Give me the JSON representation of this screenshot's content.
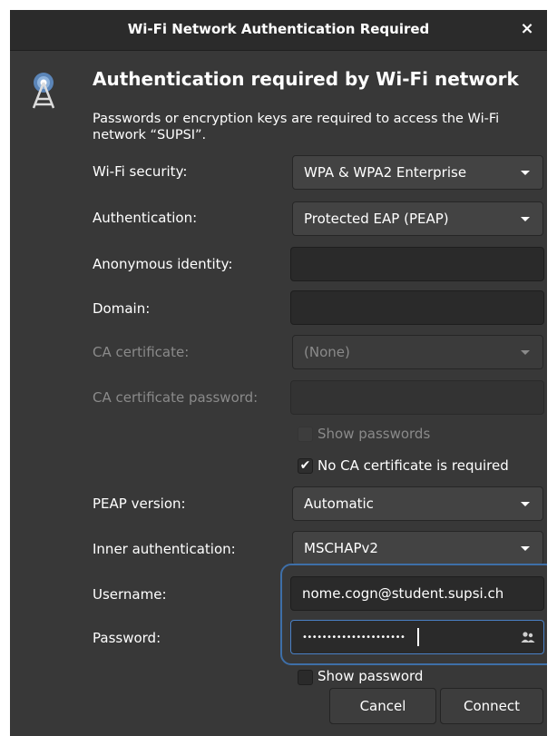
{
  "window": {
    "title": "Wi-Fi Network Authentication Required"
  },
  "icons": {
    "close": "×",
    "network_icon": "wifi-antenna-icon",
    "people_icon": "people-icon",
    "check": "✔"
  },
  "header": {
    "heading": "Authentication required by Wi-Fi network",
    "description": "Passwords or encryption keys are required to access the Wi-Fi network “SUPSI”."
  },
  "form": {
    "wifi_security": {
      "label": "Wi-Fi security:",
      "value": "WPA & WPA2 Enterprise"
    },
    "authentication": {
      "label": "Authentication:",
      "value": "Protected EAP (PEAP)"
    },
    "anonymous_identity": {
      "label": "Anonymous identity:",
      "value": ""
    },
    "domain": {
      "label": "Domain:",
      "value": ""
    },
    "ca_certificate": {
      "label": "CA certificate:",
      "value": "(None)"
    },
    "ca_certificate_password": {
      "label": "CA certificate password:",
      "value": ""
    },
    "show_passwords": {
      "label": "Show passwords",
      "checked": false,
      "disabled": true
    },
    "no_ca_required": {
      "label": "No CA certificate is required",
      "checked": true
    },
    "peap_version": {
      "label": "PEAP version:",
      "value": "Automatic"
    },
    "inner_authentication": {
      "label": "Inner authentication:",
      "value": "MSCHAPv2"
    },
    "username": {
      "label": "Username:",
      "value": "nome.cogn@student.supsi.ch"
    },
    "password": {
      "label": "Password:",
      "value": "•••••••••••••••••••••"
    },
    "show_password": {
      "label": "Show password",
      "checked": false
    }
  },
  "buttons": {
    "cancel": "Cancel",
    "connect": "Connect"
  },
  "colors": {
    "background": "#383838",
    "titlebar": "#2b2b2b",
    "focus": "#4a80c5",
    "highlight": "#3e6fa8"
  }
}
